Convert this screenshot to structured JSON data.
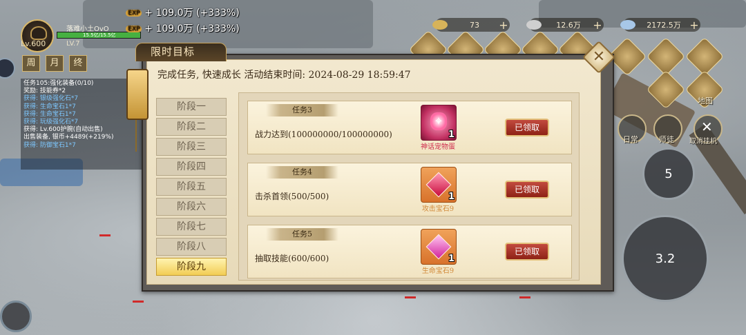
{
  "player": {
    "name": "落难小土OvO",
    "level": "Lv.600",
    "hp_text": "15.5亿/15.5亿",
    "hp_fraction": 1.0,
    "level_tag": "LV.7"
  },
  "exp_gains": [
    {
      "tag": "EXP",
      "text": "+ 109.0万 (+333%)"
    },
    {
      "tag": "EXP",
      "text": "+ 109.0万 (+333%)"
    }
  ],
  "currencies": [
    {
      "icon": "gold-ingot-icon",
      "value": "73"
    },
    {
      "icon": "silver-ingot-icon",
      "value": "12.6万"
    },
    {
      "icon": "feather-icon",
      "value": "2172.5万"
    }
  ],
  "mini_tabs": [
    "周",
    "月",
    "终"
  ],
  "quest_tracker": [
    {
      "text": "任务105:强化装备(0/10)",
      "style": "normal"
    },
    {
      "text": "奖励: 技能券*2",
      "style": "normal"
    },
    {
      "text": "获得: 银级强化石*7",
      "style": "blue"
    },
    {
      "text": "获得: 生命宝石1*7",
      "style": "blue"
    },
    {
      "text": "获得: 生命宝石1*7",
      "style": "blue"
    },
    {
      "text": "获得: 玩级强化石*7",
      "style": "blue"
    },
    {
      "text": "获得: Lv.600护腕(自动出售)",
      "style": "normal"
    },
    {
      "text": "出售装备, 银币+4489(+219%)",
      "style": "normal"
    },
    {
      "text": "获得: 防御宝石1*7",
      "style": "blue"
    }
  ],
  "right_menu": {
    "daily": "日常",
    "mentor": "师徒",
    "cancel_auto": "取消挂机",
    "map": "地图"
  },
  "skills": {
    "skill1": "5",
    "skill2": "3.2"
  },
  "dialog": {
    "title": "限时目标",
    "headline": "完成任务, 快速成长  活动结束时间: 2024-08-29  18:59:47",
    "close": "✕",
    "stages": [
      "阶段一",
      "阶段二",
      "阶段三",
      "阶段四",
      "阶段五",
      "阶段六",
      "阶段七",
      "阶段八",
      "阶段九"
    ],
    "active_stage": 8,
    "tasks": [
      {
        "tag": "任务3",
        "desc": "战力达到(100000000/100000000)",
        "reward_name": "神话宠物蛋",
        "reward_qty": "1",
        "reward_color": "#d03050",
        "button": "已领取"
      },
      {
        "tag": "任务4",
        "desc": "击杀首领(500/500)",
        "reward_name": "攻击宝石9",
        "reward_qty": "1",
        "reward_color": "#d18a3a",
        "button": "已领取"
      },
      {
        "tag": "任务5",
        "desc": "抽取技能(600/600)",
        "reward_name": "生命宝石9",
        "reward_qty": "1",
        "reward_color": "#d18a3a",
        "button": "已领取"
      }
    ]
  }
}
